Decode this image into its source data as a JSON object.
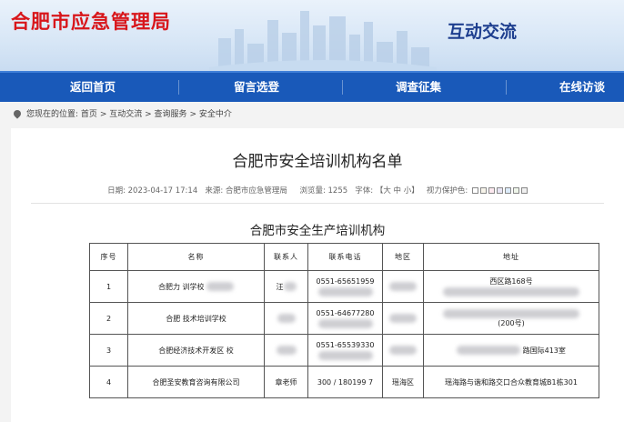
{
  "header": {
    "site_title": "合肥市应急管理局",
    "section_title": "互动交流"
  },
  "nav": {
    "items": [
      "返回首页",
      "留言选登",
      "调查征集",
      "在线访谈"
    ]
  },
  "breadcrumb": {
    "prefix": "您现在的位置:",
    "items": [
      "首页",
      "互动交流",
      "查询服务",
      "安全中介"
    ],
    "separator": ">"
  },
  "article": {
    "title": "合肥市安全培训机构名单",
    "meta_date": "日期: 2023-04-17 17:14",
    "meta_source": "来源: 合肥市应急管理局",
    "meta_views": "浏览量: 1255",
    "meta_font": "字体: 【大 中 小】",
    "meta_vision": "视力保护色:"
  },
  "table": {
    "title": "合肥市安全生产培训机构",
    "headers": [
      "序号",
      "名称",
      "联系人",
      "联系电话",
      "地区",
      "地址"
    ],
    "rows": [
      {
        "no": "1",
        "name": "合肥力  训学校",
        "contact": "汪",
        "phone": "0551-65651959",
        "region": "",
        "address": "西区路168号"
      },
      {
        "no": "2",
        "name": "合肥  技术培训学校",
        "contact": "",
        "phone": "0551-64677280",
        "region": "",
        "address": "(200号)"
      },
      {
        "no": "3",
        "name": "合肥经济技术开发区  校",
        "contact": "",
        "phone": "0551-65539330",
        "region": "",
        "address": "路国际413室"
      },
      {
        "no": "4",
        "name": "合肥圣安教育咨询有限公司",
        "contact": "章老师",
        "phone": "300 / 180199  7",
        "region": "瑶海区",
        "address": "瑶海路与谐和路交口合众教育城B1栋301"
      }
    ]
  },
  "colors": {
    "brand_red": "#d8161b",
    "nav_blue": "#1959b9",
    "section_blue": "#1e3f8f"
  }
}
